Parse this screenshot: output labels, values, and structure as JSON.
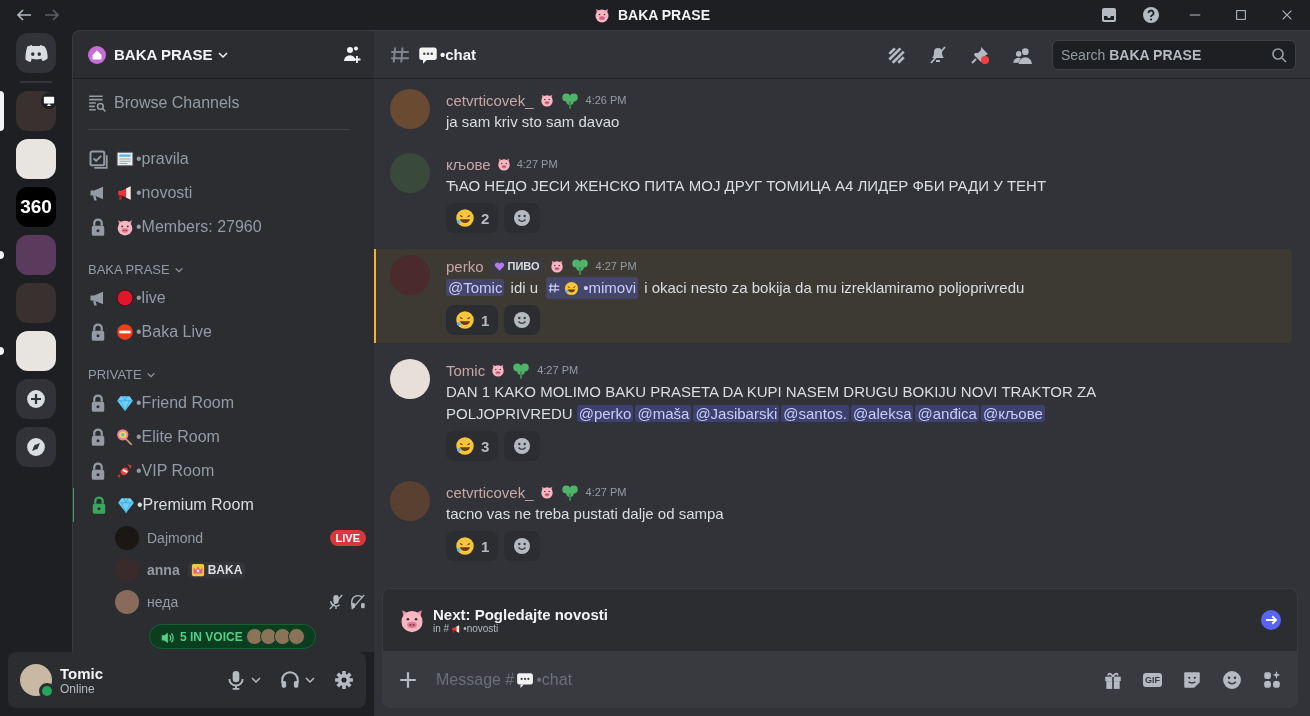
{
  "titlebar": {
    "title": "BAKA PRASE"
  },
  "servers": [
    {
      "kind": "home",
      "selected": false,
      "unread": false
    },
    {
      "kind": "image",
      "selected": true,
      "unread": false,
      "activity": true
    },
    {
      "kind": "image",
      "selected": false,
      "unread": false
    },
    {
      "kind": "text",
      "label": "360",
      "selected": false,
      "unread": false
    },
    {
      "kind": "image",
      "selected": false,
      "unread": true
    },
    {
      "kind": "image",
      "selected": false,
      "unread": false
    },
    {
      "kind": "image",
      "selected": false,
      "unread": true
    },
    {
      "kind": "add",
      "selected": false,
      "unread": false
    },
    {
      "kind": "discover",
      "selected": false,
      "unread": false
    }
  ],
  "guild": {
    "name": "BAKA PRASE"
  },
  "browse": "Browse Channels",
  "channels": [
    {
      "kind": "rules",
      "icon": {
        "kind": "newspaper"
      },
      "name": "•pravila"
    },
    {
      "kind": "announcement",
      "icon": {
        "kind": "megaphone"
      },
      "name": "•novosti"
    },
    {
      "kind": "locked",
      "icon": {
        "kind": "pig"
      },
      "name": "•Members: 27960"
    }
  ],
  "categories": [
    {
      "name": "BAKA PRASE",
      "expanded": true,
      "channels": [
        {
          "kind": "announcement",
          "icon": {
            "kind": "record"
          },
          "name": "•live"
        },
        {
          "kind": "locked",
          "icon": {
            "kind": "no-entry"
          },
          "name": "•Baka Live"
        }
      ]
    },
    {
      "name": "PRIVATE",
      "expanded": true,
      "channels": [
        {
          "kind": "locked",
          "icon": {
            "kind": "diamond"
          },
          "name": "•Friend Room",
          "connected": false
        },
        {
          "kind": "locked",
          "icon": {
            "kind": "lollipop"
          },
          "name": "•Elite Room",
          "connected": false
        },
        {
          "kind": "locked",
          "icon": {
            "kind": "candy"
          },
          "name": "•VIP Room",
          "connected": false
        },
        {
          "kind": "locked",
          "icon": {
            "kind": "diamond"
          },
          "name": "•Premium Room",
          "connected": true,
          "members": [
            {
              "name": "Dajmond",
              "live": "LIVE",
              "muted": false,
              "deafened": false
            },
            {
              "name": "anna",
              "tag": "BAKA",
              "muted": false,
              "deafened": false
            },
            {
              "name": "неда",
              "muted": true,
              "deafened": true
            }
          ]
        }
      ]
    }
  ],
  "voice_summary": "5 IN VOICE",
  "user": {
    "name": "Tomic",
    "status": "Online"
  },
  "chat": {
    "channel": "•chat",
    "search": {
      "placeholder": "Search **BAKA PRASE**"
    }
  },
  "messages": [
    {
      "author": "cetvrticovek_",
      "badges": [
        {
          "kind": "pig"
        },
        {
          "kind": "clover"
        }
      ],
      "time": "4:26 PM",
      "highlighted": false,
      "parts": [
        {
          "kind": "text",
          "text": "ja sam kriv sto sam davao"
        }
      ]
    },
    {
      "author": "кљове",
      "badges": [
        {
          "kind": "pig"
        }
      ],
      "time": "4:27 PM",
      "highlighted": false,
      "parts": [
        {
          "kind": "text",
          "text": "ЋАО НЕДО ЈЕСИ ЖЕНСКО ПИТА МОЈ ДРУГ ТОМИЦА А4 ЛИДЕР ФБИ РАДИ У ТЕНТ"
        }
      ],
      "reactions": [
        {
          "count": "2"
        }
      ]
    },
    {
      "author": "perko",
      "tag": "ПИВО",
      "badges": [
        {
          "kind": "pig"
        },
        {
          "kind": "clover"
        }
      ],
      "time": "4:27 PM",
      "highlighted": true,
      "parts": [
        {
          "kind": "mention",
          "text": "@Tomic"
        },
        {
          "kind": "text",
          "text": " idi u "
        },
        {
          "kind": "channel",
          "text": "•mimovi"
        },
        {
          "kind": "text",
          "text": " i okaci nesto za bokija da mu izreklamiramo poljoprivredu"
        }
      ],
      "reactions": [
        {
          "count": "1"
        }
      ]
    },
    {
      "author": "Tomic",
      "badges": [
        {
          "kind": "pig"
        },
        {
          "kind": "clover"
        }
      ],
      "time": "4:27 PM",
      "highlighted": false,
      "parts": [
        {
          "kind": "text",
          "text": "DAN 1 KAKO MOLIMO BAKU PRASETA DA KUPI NASEM DRUGU BOKIJU NOVI TRAKTOR ZA POLJOPRIVREDU"
        },
        {
          "kind": "mention",
          "text": "@perko"
        },
        {
          "kind": "mention",
          "text": "@maša"
        },
        {
          "kind": "mention",
          "text": "@Jasibarski"
        },
        {
          "kind": "mention",
          "text": "@santos."
        },
        {
          "kind": "mention",
          "text": "@aleksa"
        },
        {
          "kind": "mention",
          "text": "@anđica"
        },
        {
          "kind": "mention",
          "text": "@кљове"
        }
      ],
      "reactions": [
        {
          "count": "3"
        }
      ]
    },
    {
      "author": "cetvrticovek_",
      "badges": [
        {
          "kind": "pig"
        },
        {
          "kind": "clover"
        }
      ],
      "time": "4:27 PM",
      "highlighted": false,
      "parts": [
        {
          "kind": "text",
          "text": "tacno vas ne treba pustati dalje od sampa"
        }
      ],
      "reactions": [
        {
          "count": "1"
        }
      ]
    }
  ],
  "next": {
    "title": "Next: Pogledajte novosti",
    "prefix": "in #",
    "channel": "•novosti"
  },
  "composer": {
    "placeholder_start": "Message #",
    "placeholder_end": "•chat",
    "gif_label": "GIF"
  }
}
